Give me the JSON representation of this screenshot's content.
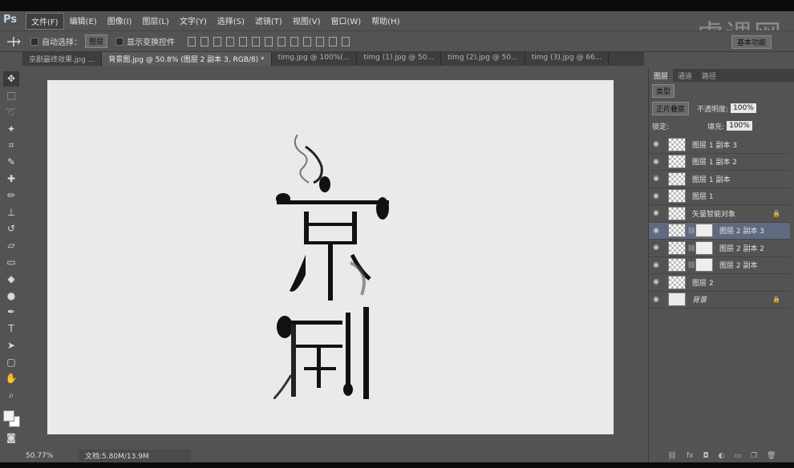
{
  "menubar": {
    "logo": "Ps",
    "items": [
      "文件(F)",
      "编辑(E)",
      "图像(I)",
      "图层(L)",
      "文字(Y)",
      "选择(S)",
      "滤镜(T)",
      "视图(V)",
      "窗口(W)",
      "帮助(H)"
    ],
    "watermark": "虎课网"
  },
  "optbar": {
    "auto_select_label": "自动选择：",
    "auto_select_value": "图层",
    "show_transform_label": "显示变换控件",
    "workspace": "基本功能"
  },
  "tabs": [
    "京剧最终效果.jpg ...",
    "背景图.jpg @ 50.8% (图层 2 副本 3, RGB/8) *",
    "timg.jpg @ 100%(...",
    "timg (1).jpg @ 50...",
    "timg (2).jpg @ 50...",
    "timg (3).jpg @ 66..."
  ],
  "status": {
    "zoom": "50.77%",
    "doc": "文档:5.80M/13.9M"
  },
  "panel": {
    "tabs": [
      "图层",
      "通道",
      "路径"
    ],
    "kind": "类型",
    "blend_mode": "正片叠底",
    "opacity_label": "不透明度:",
    "opacity_value": "100%",
    "lock_label": "锁定:",
    "fill_label": "填充:",
    "fill_value": "100%"
  },
  "layers": [
    {
      "name": "图层 1 副本 3"
    },
    {
      "name": "图层 1 副本 2"
    },
    {
      "name": "图层 1 副本"
    },
    {
      "name": "图层 1"
    },
    {
      "name": "矢量智能对象"
    },
    {
      "name": "图层 2 副本 3"
    },
    {
      "name": "图层 2 副本 2"
    },
    {
      "name": "图层 2 副本"
    },
    {
      "name": "图层 2"
    },
    {
      "name": "背景"
    }
  ]
}
